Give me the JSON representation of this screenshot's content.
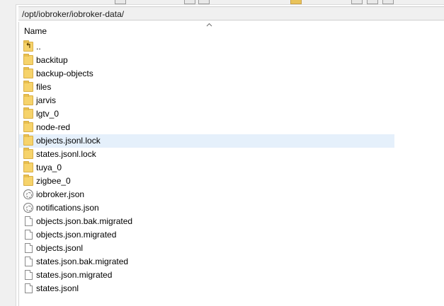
{
  "path": "/opt/iobroker/iobroker-data/",
  "column_header": "Name",
  "selected_index": 8,
  "icons": {
    "folder": "folder-icon",
    "up": "parent-folder-icon",
    "file": "file-icon",
    "json": "json-file-icon"
  },
  "entries": [
    {
      "name": "..",
      "type": "up"
    },
    {
      "name": "backitup",
      "type": "folder"
    },
    {
      "name": "backup-objects",
      "type": "folder"
    },
    {
      "name": "files",
      "type": "folder"
    },
    {
      "name": "jarvis",
      "type": "folder"
    },
    {
      "name": "lgtv_0",
      "type": "folder"
    },
    {
      "name": "node-red",
      "type": "folder"
    },
    {
      "name": "objects.jsonl.lock",
      "type": "folder"
    },
    {
      "name": "states.jsonl.lock",
      "type": "folder"
    },
    {
      "name": "tuya_0",
      "type": "folder"
    },
    {
      "name": "zigbee_0",
      "type": "folder"
    },
    {
      "name": "iobroker.json",
      "type": "json"
    },
    {
      "name": "notifications.json",
      "type": "json"
    },
    {
      "name": "objects.json.bak.migrated",
      "type": "file"
    },
    {
      "name": "objects.json.migrated",
      "type": "file"
    },
    {
      "name": "objects.jsonl",
      "type": "file"
    },
    {
      "name": "states.json.bak.migrated",
      "type": "file"
    },
    {
      "name": "states.json.migrated",
      "type": "file"
    },
    {
      "name": "states.jsonl",
      "type": "file"
    }
  ]
}
